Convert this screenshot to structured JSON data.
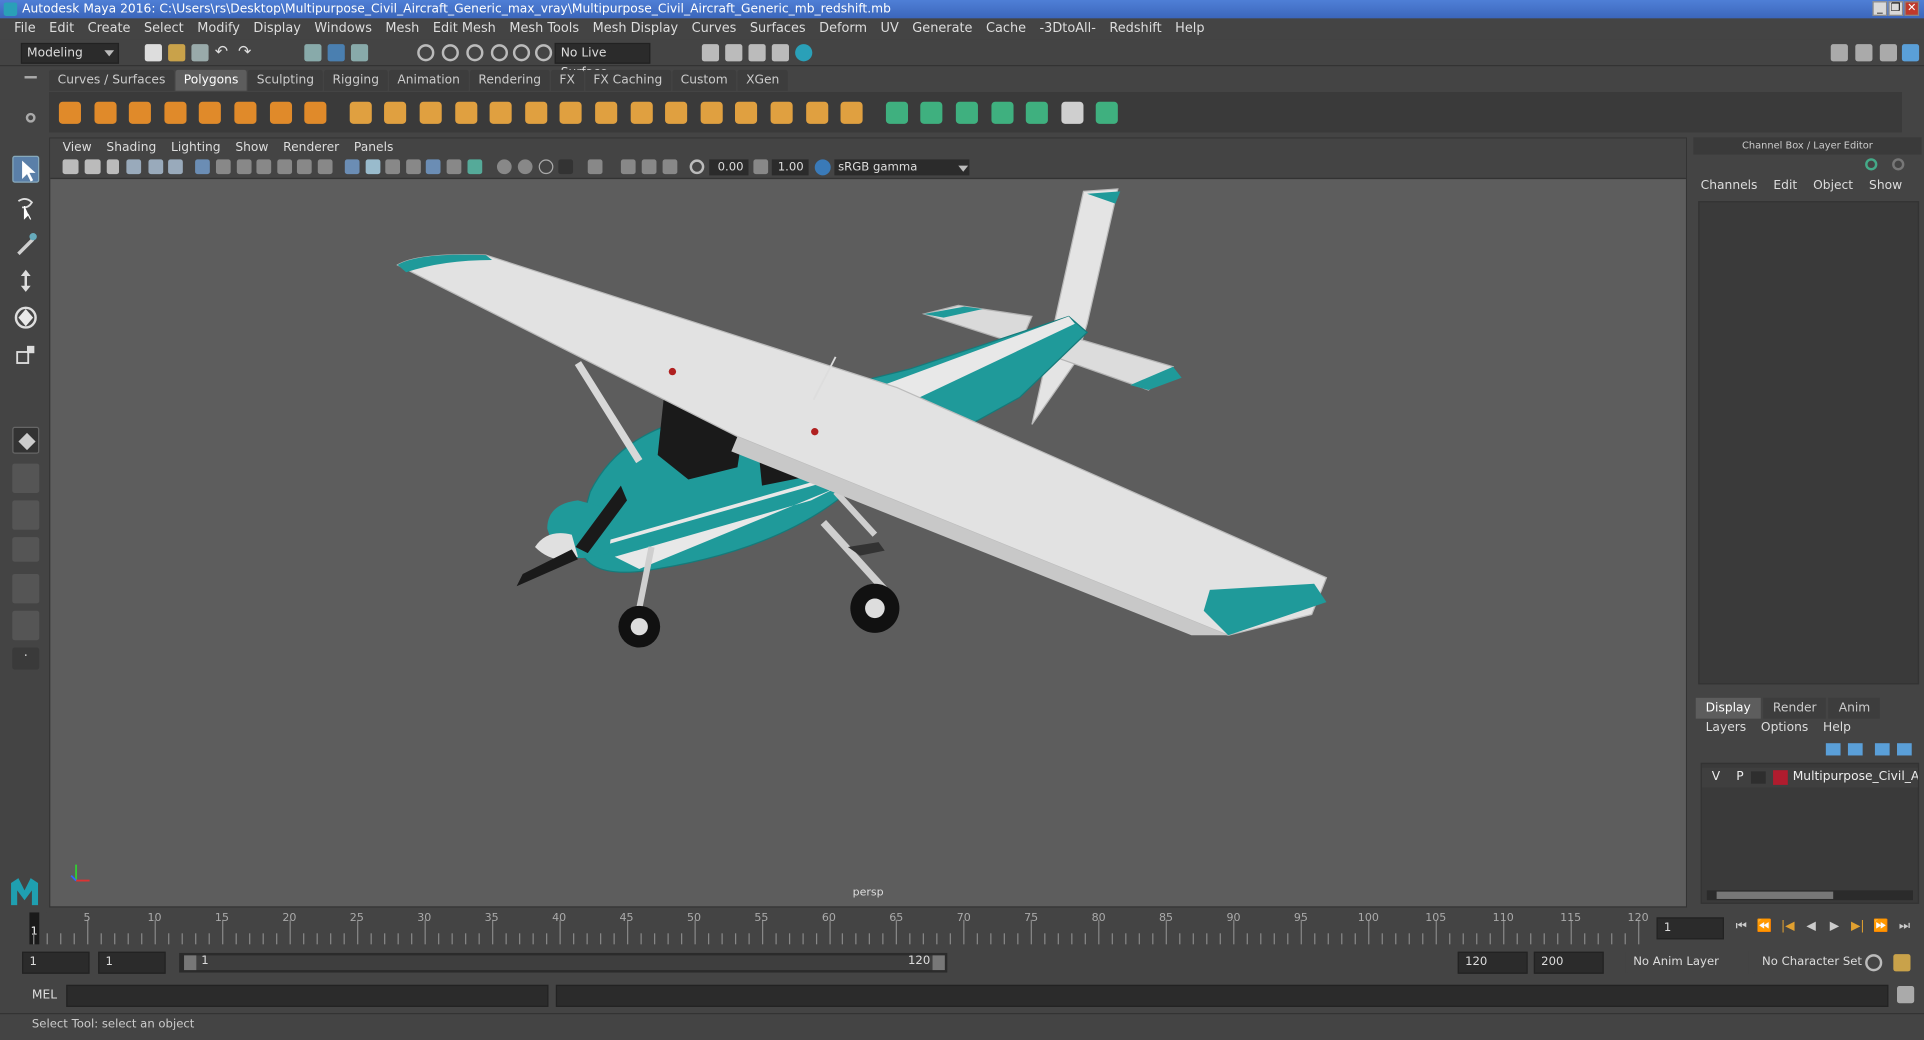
{
  "title": "Autodesk Maya 2016: C:\\Users\\rs\\Desktop\\Multipurpose_Civil_Aircraft_Generic_max_vray\\Multipurpose_Civil_Aircraft_Generic_mb_redshift.mb",
  "menus": [
    "File",
    "Edit",
    "Create",
    "Select",
    "Modify",
    "Display",
    "Windows",
    "Mesh",
    "Edit Mesh",
    "Mesh Tools",
    "Mesh Display",
    "Curves",
    "Surfaces",
    "Deform",
    "UV",
    "Generate",
    "Cache",
    "-3DtoAll-",
    "Redshift",
    "Help"
  ],
  "mode_dropdown": "Modeling",
  "live_surface": "No Live Surface",
  "shelf_tabs": [
    "Curves / Surfaces",
    "Polygons",
    "Sculpting",
    "Rigging",
    "Animation",
    "Rendering",
    "FX",
    "FX Caching",
    "Custom",
    "XGen"
  ],
  "active_shelf_tab": "Polygons",
  "viewport": {
    "menus": [
      "View",
      "Shading",
      "Lighting",
      "Show",
      "Renderer",
      "Panels"
    ],
    "exposure": "0.00",
    "gamma": "1.00",
    "color_space": "sRGB gamma",
    "camera_label": "persp"
  },
  "channel_box": {
    "header": "Channel Box / Layer Editor",
    "menus": [
      "Channels",
      "Edit",
      "Object",
      "Show"
    ]
  },
  "layer_editor": {
    "tabs": [
      "Display",
      "Render",
      "Anim"
    ],
    "active_tab": "Display",
    "menus": [
      "Layers",
      "Options",
      "Help"
    ],
    "layer": {
      "v": "V",
      "p": "P",
      "name": "Multipurpose_Civil_Aircr",
      "color": "#b01c2e"
    }
  },
  "timeline": {
    "ticks": [
      "1",
      "5",
      "10",
      "15",
      "20",
      "25",
      "30",
      "35",
      "40",
      "45",
      "50",
      "55",
      "60",
      "65",
      "70",
      "75",
      "80",
      "85",
      "90",
      "95",
      "100",
      "105",
      "110",
      "115",
      "120"
    ],
    "current_frame": "1"
  },
  "range": {
    "start": "1",
    "playback_start": "1",
    "slider_start": "1",
    "slider_end": "120",
    "playback_end": "120",
    "end": "200",
    "anim_layer": "No Anim Layer",
    "character_set": "No Character Set"
  },
  "command_line": {
    "label": "MEL"
  },
  "status_text": "Select Tool: select an object",
  "colors": {
    "teal": "#1f9a9a",
    "wing": "#dcdcdc",
    "viewport_bg": "#5d5d5d"
  }
}
